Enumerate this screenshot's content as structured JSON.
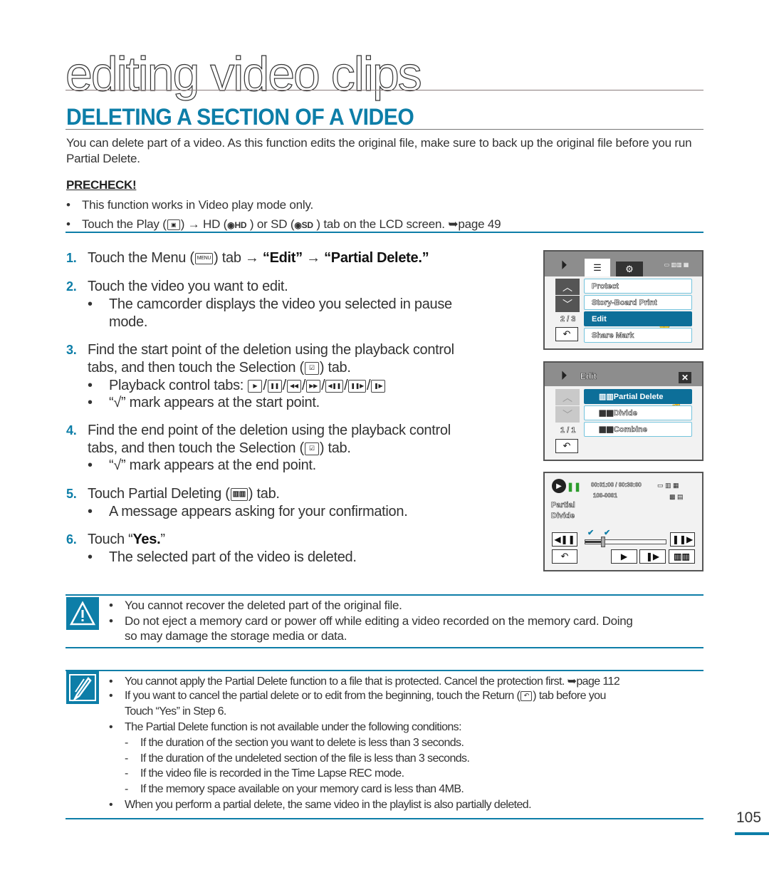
{
  "chapter_title": "editing video clips",
  "section_title": "DELETING A SECTION OF A VIDEO",
  "intro": "You can delete part of a video. As this function edits the original file, make sure to back up the original file before you run Partial Delete.",
  "precheck": {
    "title": "PRECHECK!",
    "items": [
      "This function works in Video play mode only.",
      {
        "pre": "Touch the Play (",
        "play_icon": "▣",
        "mid1": ") → HD (",
        "hd_label": "HD",
        "mid2": " ) or SD (",
        "sd_label": "SD",
        "post": " ) tab on the LCD screen. ➥page 49"
      }
    ]
  },
  "steps": [
    {
      "num": "1.",
      "pre": "Touch the Menu (",
      "icon": "MENU",
      "mid": ") tab → ",
      "b1": "“Edit”",
      "arrow": " → ",
      "b2": "“Partial Delete.”"
    },
    {
      "num": "2.",
      "text": "Touch the video you want to edit.",
      "bullets": [
        "The camcorder displays the video you selected in pause",
        "mode."
      ]
    },
    {
      "num": "3.",
      "text": "Find the start point of the deletion using the playback control",
      "cont_pre": "tabs, and then touch the Selection (",
      "cont_post": ") tab.",
      "bullets": [
        "Playback control tabs:",
        "“√” mark appears at the start point."
      ],
      "control_icons": [
        "▶",
        "❚❚",
        "◀◀",
        "▶▶",
        "◀❚❚",
        "❚❚▶",
        "❚▶"
      ]
    },
    {
      "num": "4.",
      "text": "Find the end point of the deletion using the playback control",
      "cont_pre": "tabs, and then touch the Selection (",
      "cont_post": ") tab.",
      "bullets": [
        "“√” mark appears at the end point."
      ]
    },
    {
      "num": "5.",
      "pre": "Touch Partial Deleting (",
      "post": ") tab.",
      "bullets": [
        "A message appears asking for your confirmation."
      ]
    },
    {
      "num": "6.",
      "pre": "Touch “",
      "b": "Yes.",
      "post": "”",
      "bullets": [
        "The selected part of the video is deleted."
      ]
    }
  ],
  "lcd1": {
    "pager": "2 / 3",
    "items": [
      "Protect",
      "Story-Board Print",
      "Edit",
      "Share Mark"
    ],
    "selected": "Edit"
  },
  "lcd2": {
    "title": "Edit",
    "pager": "1 / 1",
    "items": [
      "Partial Delete",
      "Divide",
      "Combine"
    ],
    "selected": "Partial Delete"
  },
  "lcd3": {
    "time": "00:01:00 / 00:30:00",
    "file": "100-0001",
    "mode_line1": "Partial",
    "mode_line2": "Divide",
    "slider_progress": 0.22
  },
  "warning": {
    "items": [
      "You cannot recover the deleted part of the original file.",
      "Do not eject a memory card or power off while editing a video recorded on the memory card. Doing",
      "so may damage the storage media or data."
    ]
  },
  "note": {
    "item1": "You cannot apply the Partial Delete function to a file that is protected. Cancel the protection first. ➥page 112",
    "item2_pre": "If you want to cancel the partial delete or to edit from the beginning, touch the Return (",
    "item2_post": ") tab before you",
    "item2_cont": "Touch “Yes” in Step 6.",
    "item3": "The Partial Delete function is not available under the following conditions:",
    "conditions": [
      "If the duration of the section you want to delete is less than 3 seconds.",
      "If the duration of the undeleted section of the file is less than 3 seconds.",
      "If the video file is recorded in the Time Lapse REC mode.",
      "If the memory space available on your memory card is less than 4MB."
    ],
    "item4": "When you perform a partial delete, the same video in the playlist is also partially deleted."
  },
  "page_number": "105",
  "colors": {
    "accent": "#0d7ea8",
    "selected": "#0d6f99"
  }
}
